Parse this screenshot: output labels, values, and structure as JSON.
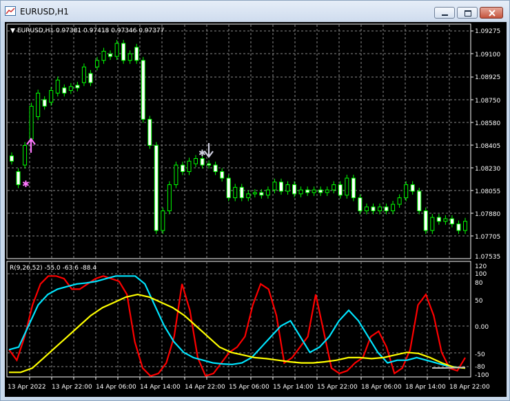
{
  "window": {
    "title": "EURUSD,H1",
    "buttons": [
      "minimize",
      "maximize",
      "close"
    ]
  },
  "main_chart": {
    "header": "EURUSD,H1  0.97381 0.97418 0.97346 0.97377",
    "price_labels": [
      "1.09275",
      "1.09100",
      "1.08925",
      "1.08750",
      "1.08580",
      "1.08405",
      "1.08230",
      "1.08055",
      "1.07880",
      "1.07705",
      "1.07535"
    ],
    "candle_color": "#00ff00",
    "signals": [
      {
        "type": "buy-arrow",
        "color": "#ff77ff"
      },
      {
        "type": "sell-arrow",
        "color": "#d0d0e0"
      }
    ]
  },
  "indicator": {
    "header": "R(9,26,52) -55.0 -63.6 -88.4",
    "scale_labels": [
      "120",
      "100",
      "80",
      "50",
      "0.00",
      "-50",
      "-80",
      "-100"
    ],
    "colors": {
      "fast": "#ff0000",
      "mid": "#00e5ff",
      "slow": "#ffff00",
      "signal": "#c0c0c0"
    }
  },
  "time_axis": [
    "13 Apr 2022",
    "13 Apr 22:00",
    "14 Apr 06:00",
    "14 Apr 14:00",
    "14 Apr 22:00",
    "15 Apr 06:00",
    "15 Apr 14:00",
    "15 Apr 22:00",
    "18 Apr 06:00",
    "18 Apr 14:00",
    "18 Apr 22:00"
  ]
}
